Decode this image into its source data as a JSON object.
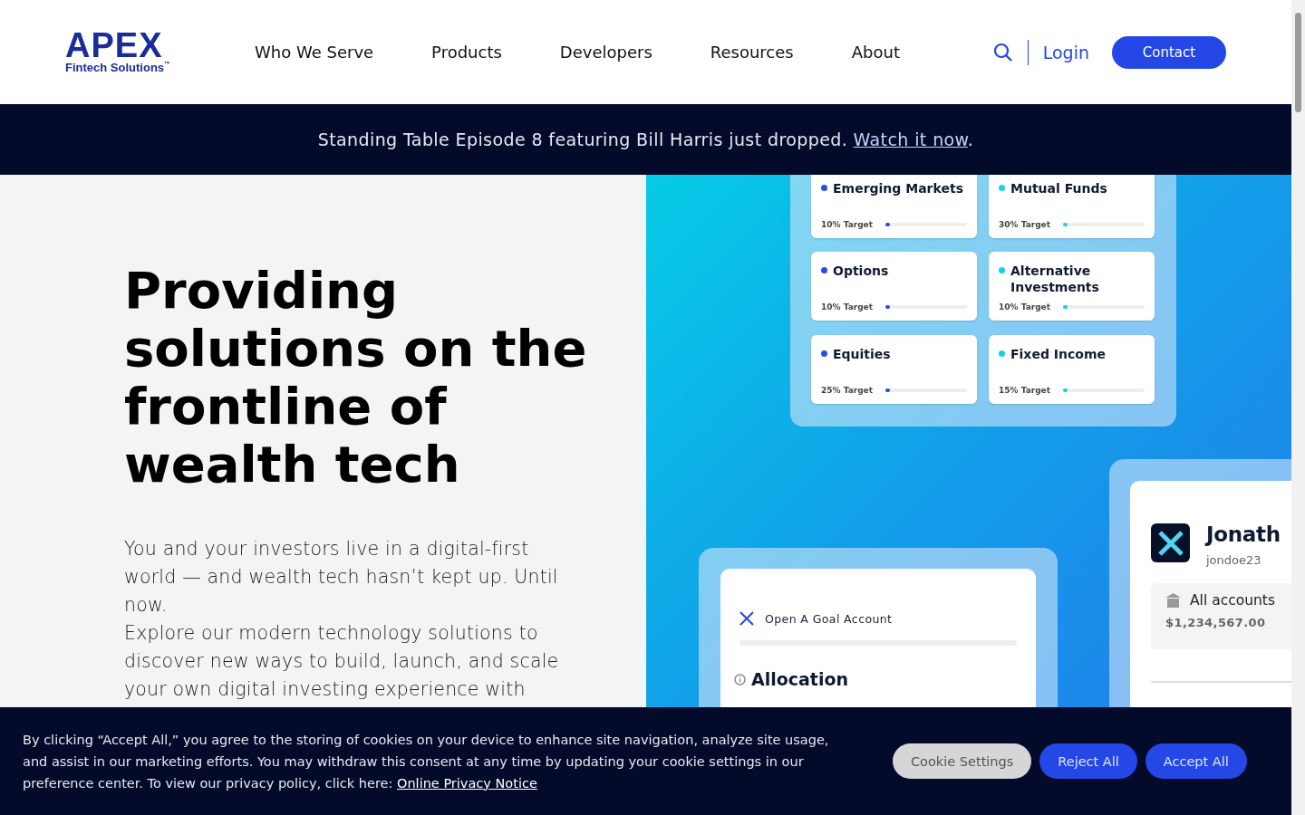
{
  "header": {
    "logo": {
      "wordmark": "APEX",
      "tagline": "Fintech Solutions",
      "trademark": "™"
    },
    "nav": [
      "Who We Serve",
      "Products",
      "Developers",
      "Resources",
      "About"
    ],
    "login": "Login",
    "contact": "Contact"
  },
  "announcement": {
    "text": "Standing Table Episode 8 featuring Bill Harris just dropped. ",
    "link": "Watch it now",
    "end": "."
  },
  "hero": {
    "heading": "Providing solutions on the frontline of wealth tech",
    "paragraphs": [
      "You and your investors live in a digital-first world — and wealth tech hasn’t kept up. Until now.",
      "Explore our modern technology solutions to discover new ways to build, launch, and scale your own digital investing experience with"
    ]
  },
  "allocations": [
    {
      "name": "Emerging Markets",
      "target": "10% Target",
      "color": "#2a4fe0",
      "level": 0.05
    },
    {
      "name": "Mutual Funds",
      "target": "30% Target",
      "color": "#16d0ec",
      "level": 0.05
    },
    {
      "name": "Options",
      "target": "10% Target",
      "color": "#2a4fe0",
      "level": 0.05
    },
    {
      "name": "Alternative Investments",
      "target": "10% Target",
      "color": "#16d0ec",
      "level": 0.05
    },
    {
      "name": "Equities",
      "target": "25% Target",
      "color": "#2a4fe0",
      "level": 0.05
    },
    {
      "name": "Fixed Income",
      "target": "15% Target",
      "color": "#16d0ec",
      "level": 0.05
    }
  ],
  "goal_card": {
    "title": "Open A Goal Account",
    "section": "Allocation"
  },
  "account_card": {
    "name": "Jonath",
    "username": "jondoe23",
    "accounts_label": "All accounts",
    "balance": "$1,234,567.00"
  },
  "cookie_banner": {
    "text": "By clicking “Accept All,” you agree to the storing of cookies on your device to enhance site navigation, analyze site usage, and assist in our marketing efforts. You may withdraw this consent at any time by updating your cookie settings in our preference center. To view our privacy policy, click here: ",
    "link": "Online Privacy Notice",
    "buttons": [
      {
        "label": "Cookie Settings",
        "kind": "secondary"
      },
      {
        "label": "Reject All",
        "kind": "primary"
      },
      {
        "label": "Accept All",
        "kind": "primary"
      }
    ]
  }
}
